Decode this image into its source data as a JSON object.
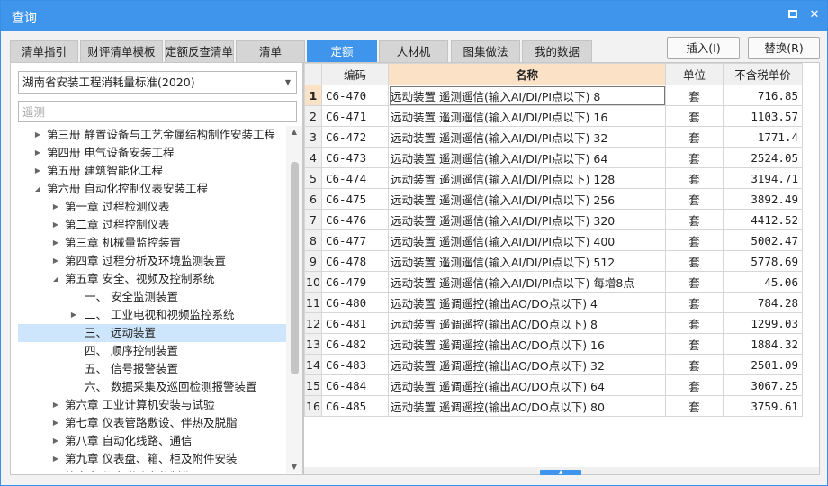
{
  "window": {
    "title": "查询"
  },
  "tabs": [
    "清单指引",
    "财评清单模板",
    "定额反查清单",
    "清单",
    "定额",
    "人材机",
    "图集做法",
    "我的数据"
  ],
  "active_tab": 4,
  "actions": {
    "insert": "插入(I)",
    "replace": "替换(R)"
  },
  "left": {
    "standard_select": "湖南省安装工程消耗量标准(2020)",
    "search_placeholder": "遥测",
    "tree": [
      {
        "label": "第三册 静置设备与工艺金属结构制作安装工程",
        "level": 0,
        "toggle": "collapsed"
      },
      {
        "label": "第四册 电气设备安装工程",
        "level": 0,
        "toggle": "collapsed"
      },
      {
        "label": "第五册 建筑智能化工程",
        "level": 0,
        "toggle": "collapsed"
      },
      {
        "label": "第六册 自动化控制仪表安装工程",
        "level": 0,
        "toggle": "expanded"
      },
      {
        "label": "第一章 过程检测仪表",
        "level": 1,
        "toggle": "collapsed"
      },
      {
        "label": "第二章 过程控制仪表",
        "level": 1,
        "toggle": "collapsed"
      },
      {
        "label": "第三章 机械量监控装置",
        "level": 1,
        "toggle": "collapsed"
      },
      {
        "label": "第四章 过程分析及环境监测装置",
        "level": 1,
        "toggle": "collapsed"
      },
      {
        "label": "第五章 安全、视频及控制系统",
        "level": 1,
        "toggle": "expanded"
      },
      {
        "label": "一、 安全监测装置",
        "level": 2,
        "toggle": "none"
      },
      {
        "label": "二、 工业电视和视频监控系统",
        "level": 2,
        "toggle": "collapsed"
      },
      {
        "label": "三、 远动装置",
        "level": 2,
        "toggle": "none",
        "selected": true
      },
      {
        "label": "四、 顺序控制装置",
        "level": 2,
        "toggle": "none"
      },
      {
        "label": "五、 信号报警装置",
        "level": 2,
        "toggle": "none"
      },
      {
        "label": "六、 数据采集及巡回检测报警装置",
        "level": 2,
        "toggle": "none"
      },
      {
        "label": "第六章 工业计算机安装与试验",
        "level": 1,
        "toggle": "collapsed"
      },
      {
        "label": "第七章 仪表管路敷设、伴热及脱脂",
        "level": 1,
        "toggle": "collapsed"
      },
      {
        "label": "第八章 自动化线路、通信",
        "level": 1,
        "toggle": "collapsed"
      },
      {
        "label": "第九章 仪表盘、箱、柜及附件安装",
        "level": 1,
        "toggle": "collapsed"
      },
      {
        "label": "第十章 仪表附件安装制作",
        "level": 1,
        "toggle": "collapsed"
      }
    ]
  },
  "grid": {
    "columns": {
      "code": "编码",
      "name": "名称",
      "unit": "单位",
      "price": "不含税单价"
    },
    "rows": [
      {
        "no": "1",
        "code": "C6-470",
        "name": "远动装置 遥测遥信(输入AI/DI/PI点以下) 8",
        "unit": "套",
        "price": "716.85"
      },
      {
        "no": "2",
        "code": "C6-471",
        "name": "远动装置 遥测遥信(输入AI/DI/PI点以下) 16",
        "unit": "套",
        "price": "1103.57"
      },
      {
        "no": "3",
        "code": "C6-472",
        "name": "远动装置 遥测遥信(输入AI/DI/PI点以下) 32",
        "unit": "套",
        "price": "1771.4"
      },
      {
        "no": "4",
        "code": "C6-473",
        "name": "远动装置 遥测遥信(输入AI/DI/PI点以下) 64",
        "unit": "套",
        "price": "2524.05"
      },
      {
        "no": "5",
        "code": "C6-474",
        "name": "远动装置 遥测遥信(输入AI/DI/PI点以下) 128",
        "unit": "套",
        "price": "3194.71"
      },
      {
        "no": "6",
        "code": "C6-475",
        "name": "远动装置 遥测遥信(输入AI/DI/PI点以下) 256",
        "unit": "套",
        "price": "3892.49"
      },
      {
        "no": "7",
        "code": "C6-476",
        "name": "远动装置 遥测遥信(输入AI/DI/PI点以下) 320",
        "unit": "套",
        "price": "4412.52"
      },
      {
        "no": "8",
        "code": "C6-477",
        "name": "远动装置 遥测遥信(输入AI/DI/PI点以下) 400",
        "unit": "套",
        "price": "5002.47"
      },
      {
        "no": "9",
        "code": "C6-478",
        "name": "远动装置 遥测遥信(输入AI/DI/PI点以下) 512",
        "unit": "套",
        "price": "5778.69"
      },
      {
        "no": "10",
        "code": "C6-479",
        "name": "远动装置 遥测遥信(输入AI/DI/PI点以下) 每增8点",
        "unit": "套",
        "price": "45.06"
      },
      {
        "no": "11",
        "code": "C6-480",
        "name": "远动装置 遥调遥控(输出AO/DO点以下) 4",
        "unit": "套",
        "price": "784.28"
      },
      {
        "no": "12",
        "code": "C6-481",
        "name": "远动装置 遥调遥控(输出AO/DO点以下) 8",
        "unit": "套",
        "price": "1299.03"
      },
      {
        "no": "13",
        "code": "C6-482",
        "name": "远动装置 遥调遥控(输出AO/DO点以下) 16",
        "unit": "套",
        "price": "1884.32"
      },
      {
        "no": "14",
        "code": "C6-483",
        "name": "远动装置 遥调遥控(输出AO/DO点以下) 32",
        "unit": "套",
        "price": "2501.09"
      },
      {
        "no": "15",
        "code": "C6-484",
        "name": "远动装置 遥调遥控(输出AO/DO点以下) 64",
        "unit": "套",
        "price": "3067.25"
      },
      {
        "no": "16",
        "code": "C6-485",
        "name": "远动装置 遥调遥控(输出AO/DO点以下) 80",
        "unit": "套",
        "price": "3759.61"
      }
    ]
  },
  "colors": {
    "accent": "#3f95ec",
    "header_highlight": "#fbe2c6",
    "selection": "#cde6fb"
  },
  "icons": {
    "maximize": "maximize-icon",
    "close": "close-icon"
  }
}
